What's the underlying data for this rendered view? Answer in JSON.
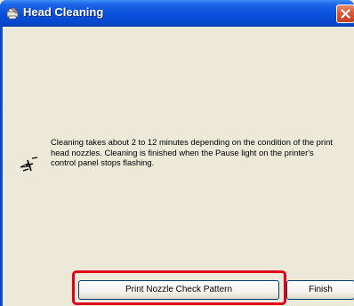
{
  "window": {
    "title": "Head Cleaning",
    "icon": "printer-wrench-icon",
    "close_icon": "close-icon"
  },
  "main": {
    "instruction_icon": "pencil-nozzle-icon",
    "message": "Cleaning takes about 2 to 12 minutes depending on the condition of the print head nozzles. Cleaning is finished when the Pause light on the printer's control panel stops flashing."
  },
  "buttons": {
    "print_nozzle_check_label": "Print Nozzle Check Pattern",
    "finish_label": "Finish"
  },
  "colors": {
    "titlebar": "#0a4fd8",
    "dialog_bg": "#ece9d8",
    "highlight": "#e0001a"
  }
}
